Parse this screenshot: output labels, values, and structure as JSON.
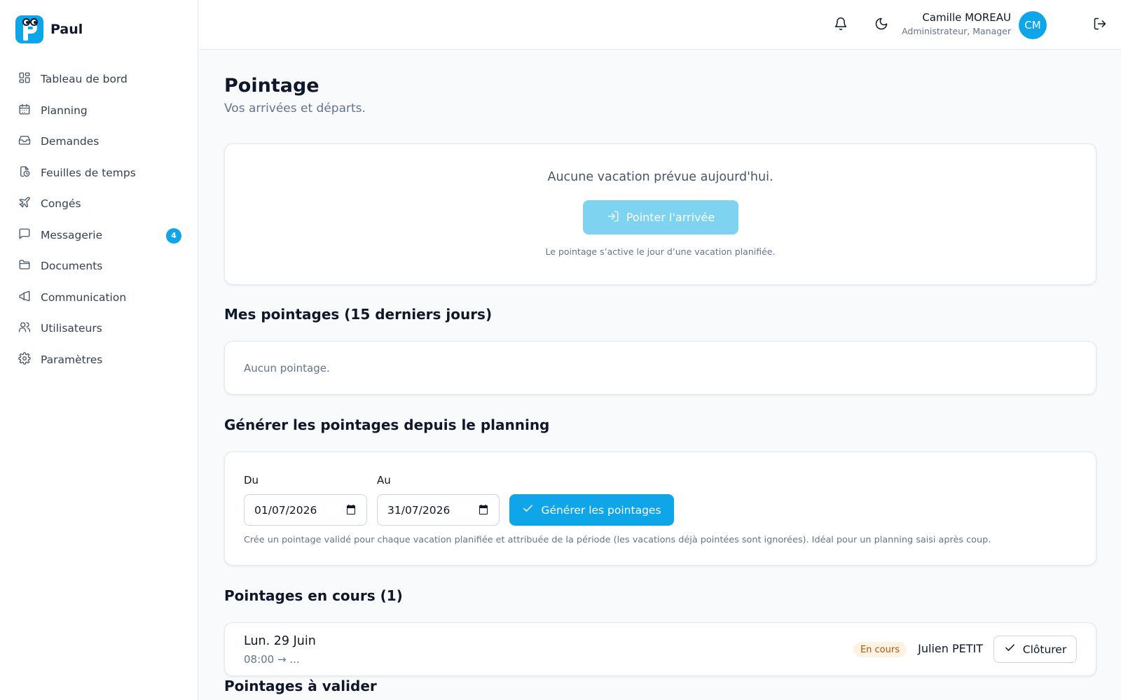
{
  "app": {
    "name": "Paul"
  },
  "sidebar": {
    "items": [
      {
        "label": "Tableau de bord",
        "icon": "dashboard-icon"
      },
      {
        "label": "Planning",
        "icon": "calendar-icon"
      },
      {
        "label": "Demandes",
        "icon": "inbox-icon"
      },
      {
        "label": "Feuilles de temps",
        "icon": "timesheet-icon"
      },
      {
        "label": "Congés",
        "icon": "plane-icon"
      },
      {
        "label": "Messagerie",
        "icon": "message-icon",
        "badge": "4"
      },
      {
        "label": "Documents",
        "icon": "folder-icon"
      },
      {
        "label": "Communication",
        "icon": "megaphone-icon"
      },
      {
        "label": "Utilisateurs",
        "icon": "users-icon"
      },
      {
        "label": "Paramètres",
        "icon": "gear-icon"
      }
    ]
  },
  "header": {
    "user_name": "Camille MOREAU",
    "user_role": "Administrateur, Manager",
    "avatar_initials": "CM"
  },
  "page": {
    "title": "Pointage",
    "subtitle": "Vos arrivées et départs."
  },
  "today": {
    "message": "Aucune vacation prévue aujourd'hui.",
    "button_label": "Pointer l'arrivée",
    "hint": "Le pointage s’active le jour d’une vacation planifiée."
  },
  "mine": {
    "title": "Mes pointages (15 derniers jours)",
    "empty": "Aucun pointage."
  },
  "generate": {
    "title": "Générer les pointages depuis le planning",
    "from_label": "Du",
    "from_value": "01/07/2026",
    "to_label": "Au",
    "to_value": "31/07/2026",
    "button_label": "Générer les pointages",
    "hint": "Crée un pointage validé pour chaque vacation planifiée et attribuée de la période (les vacations déjà pointées sont ignorées). Idéal pour un planning saisi après coup."
  },
  "current": {
    "title": "Pointages en cours (1)",
    "rows": [
      {
        "date": "Lun. 29 Juin",
        "time": "08:00 → ...",
        "status": "En cours",
        "person": "Julien PETIT",
        "action": "Clôturer"
      }
    ]
  },
  "pending": {
    "title": "Pointages à valider"
  },
  "colors": {
    "accent": "#0ea5e9",
    "accent_disabled": "#7dd3f0",
    "status_bg": "#fef3e2",
    "status_text": "#b45309"
  }
}
